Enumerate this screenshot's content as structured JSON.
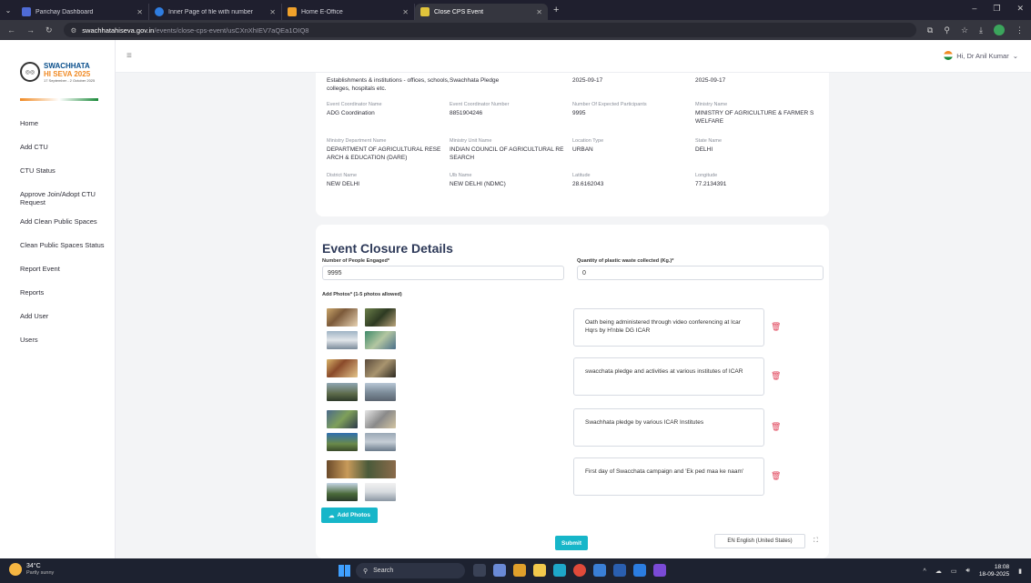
{
  "browser": {
    "tabs": [
      {
        "label": "Parichay Dashboard",
        "favicon_color": "#4f6bd6"
      },
      {
        "label": "Inner Page of file with number",
        "favicon_color": "#2f7de1"
      },
      {
        "label": "Home E-Office",
        "favicon_color": "#f0a12b"
      },
      {
        "label": "Close CPS Event",
        "favicon_color": "#e0c43b"
      }
    ],
    "url_host": "swachhatahiseva.gov.in",
    "url_path": "/events/close-cps-event/usCXnXhIEV7aQEa1OIQ8"
  },
  "brand": {
    "line1": "SWACHHATA",
    "line2": "HI SEVA 2025",
    "tagline": "17 September - 2 October 2025"
  },
  "sidebar": {
    "items": [
      {
        "label": "Home"
      },
      {
        "label": "Add CTU"
      },
      {
        "label": "CTU Status"
      },
      {
        "label": "Approve Join/Adopt CTU Request"
      },
      {
        "label": "Add Clean Public Spaces"
      },
      {
        "label": "Clean Public Spaces Status"
      },
      {
        "label": "Report Event"
      },
      {
        "label": "Reports"
      },
      {
        "label": "Add User"
      },
      {
        "label": "Users"
      }
    ]
  },
  "user": {
    "greeting": "Hi, Dr Anil Kumar"
  },
  "event_details": {
    "row0": [
      {
        "value": "Establishments & institutions - offices, schools, colleges, hospitals etc."
      },
      {
        "value": "Swachhata Pledge"
      },
      {
        "value": "2025-09-17"
      },
      {
        "value": "2025-09-17"
      }
    ],
    "row1": [
      {
        "label": "Event Coordinator Name",
        "value": "ADG Coordination"
      },
      {
        "label": "Event Coordinator Number",
        "value": "8851904246"
      },
      {
        "label": "Number Of Expected Participants",
        "value": "9995"
      },
      {
        "label": "Ministry Name",
        "value": "MINISTRY OF AGRICULTURE & FARMER S WELFARE"
      }
    ],
    "row2": [
      {
        "label": "Ministry Department Name",
        "value": "DEPARTMENT OF AGRICULTURAL RESE ARCH & EDUCATION (DARE)"
      },
      {
        "label": "Ministry Unit Name",
        "value": "INDIAN COUNCIL OF AGRICULTURAL RE SEARCH"
      },
      {
        "label": "Location Type",
        "value": "URBAN"
      },
      {
        "label": "State Name",
        "value": "DELHI"
      }
    ],
    "row3": [
      {
        "label": "District Name",
        "value": "NEW DELHI"
      },
      {
        "label": "Ulb Name",
        "value": "NEW DELHI (NDMC)"
      },
      {
        "label": "Latitude",
        "value": "28.6162043"
      },
      {
        "label": "Longitude",
        "value": "77.2134391"
      }
    ]
  },
  "closure": {
    "title": "Event Closure Details",
    "people_label": "Number of People Engaged*",
    "people_value": "9995",
    "plastic_label": "Quantity of plastic waste collected (Kg.)*",
    "plastic_value": "0",
    "photos_label": "Add Photos* (1-5 photos allowed)",
    "captions": [
      "Oath being administered through video conferencing at Icar Hqrs by H'nble DG ICAR",
      "swacchata pledge and activities at various institutes of ICAR",
      "Swachhata pledge by various ICAR Institutes",
      "First day of Swacchata campaign and 'Ek ped maa ke naam'"
    ],
    "add_photos_label": "Add Photos",
    "submit_label": "Submit",
    "language": "EN English (United States)"
  },
  "taskbar": {
    "temp": "34°C",
    "weather": "Partly sunny",
    "search": "Search",
    "time": "18:08",
    "date": "18-09-2025"
  },
  "colors": {
    "accent": "#17b6c9",
    "delete": "#e0445a"
  }
}
